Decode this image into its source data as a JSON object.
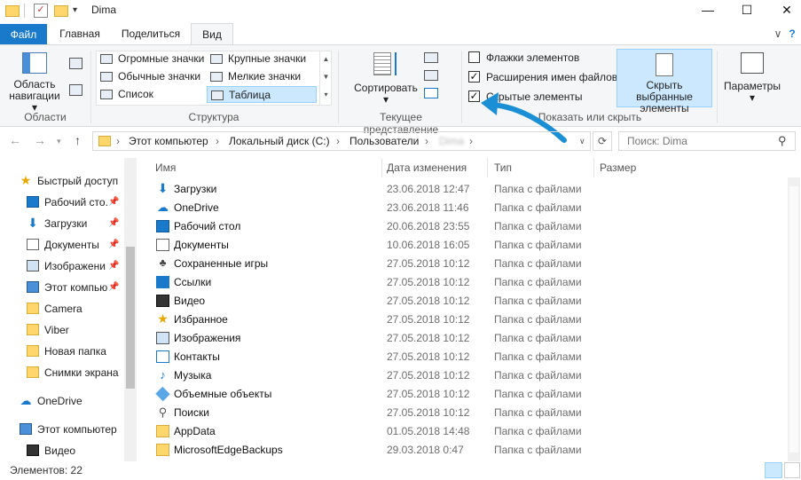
{
  "window": {
    "title": "Dima",
    "minimize": "—",
    "maximize": "☐",
    "close": "✕"
  },
  "tabs": {
    "file": "Файл",
    "home": "Главная",
    "share": "Поделиться",
    "view": "Вид",
    "help": "?",
    "collapse": "∨"
  },
  "ribbon": {
    "nav_pane": {
      "label_line1": "Область",
      "label_line2": "навигации ▾",
      "group": "Области"
    },
    "layout": {
      "items": [
        "Огромные значки",
        "Крупные значки",
        "Обычные значки",
        "Мелкие значки",
        "Список",
        "Таблица"
      ],
      "selected": "Таблица",
      "group": "Структура"
    },
    "current_view": {
      "sort_label": "Сортировать",
      "sort_arrow": "▾",
      "group": "Текущее представление"
    },
    "show_hide": {
      "checkboxes": [
        {
          "label": "Флажки элементов",
          "checked": false
        },
        {
          "label": "Расширения имен файлов",
          "checked": true
        },
        {
          "label": "Скрытые элементы",
          "checked": true
        }
      ],
      "hide_selected_line1": "Скрыть выбранные",
      "hide_selected_line2": "элементы",
      "group": "Показать или скрыть"
    },
    "options": {
      "label": "Параметры",
      "arrow": "▾"
    }
  },
  "address": {
    "crumbs": [
      "Этот компьютер",
      "Локальный диск (C:)",
      "Пользователи",
      "Dima"
    ],
    "separator": "›",
    "search_placeholder": "Поиск: Dima"
  },
  "nav_pane": {
    "items": [
      {
        "label": "Быстрый доступ",
        "icon": "star-icon"
      },
      {
        "label": "Рабочий сто.",
        "icon": "desktop-icon",
        "pinned": true
      },
      {
        "label": "Загрузки",
        "icon": "download-icon",
        "pinned": true
      },
      {
        "label": "Документы",
        "icon": "document-icon",
        "pinned": true
      },
      {
        "label": "Изображени",
        "icon": "pictures-icon",
        "pinned": true
      },
      {
        "label": "Этот компью",
        "icon": "computer-icon",
        "pinned": true
      },
      {
        "label": "Camera",
        "icon": "folder-icon"
      },
      {
        "label": "Viber",
        "icon": "folder-icon"
      },
      {
        "label": "Новая папка",
        "icon": "folder-icon"
      },
      {
        "label": "Снимки экрана",
        "icon": "folder-icon"
      },
      {
        "label": "OneDrive",
        "icon": "cloud-icon"
      },
      {
        "label": "Этот компьютер",
        "icon": "computer-icon"
      },
      {
        "label": "Видео",
        "icon": "video-icon"
      }
    ]
  },
  "columns": {
    "name": "Имя",
    "date": "Дата изменения",
    "type": "Тип",
    "size": "Размер"
  },
  "files": [
    {
      "name": "Загрузки",
      "date": "23.06.2018 12:47",
      "type": "Папка с файлами",
      "icon": "download-icon"
    },
    {
      "name": "OneDrive",
      "date": "23.06.2018 11:46",
      "type": "Папка с файлами",
      "icon": "cloud-icon"
    },
    {
      "name": "Рабочий стол",
      "date": "20.06.2018 23:55",
      "type": "Папка с файлами",
      "icon": "desktop-icon"
    },
    {
      "name": "Документы",
      "date": "10.06.2018 16:05",
      "type": "Папка с файлами",
      "icon": "document-icon"
    },
    {
      "name": "Сохраненные игры",
      "date": "27.05.2018 10:12",
      "type": "Папка с файлами",
      "icon": "game-icon"
    },
    {
      "name": "Ссылки",
      "date": "27.05.2018 10:12",
      "type": "Папка с файлами",
      "icon": "link-icon"
    },
    {
      "name": "Видео",
      "date": "27.05.2018 10:12",
      "type": "Папка с файлами",
      "icon": "video-icon"
    },
    {
      "name": "Избранное",
      "date": "27.05.2018 10:12",
      "type": "Папка с файлами",
      "icon": "star-icon"
    },
    {
      "name": "Изображения",
      "date": "27.05.2018 10:12",
      "type": "Папка с файлами",
      "icon": "pictures-icon"
    },
    {
      "name": "Контакты",
      "date": "27.05.2018 10:12",
      "type": "Папка с файлами",
      "icon": "contacts-icon"
    },
    {
      "name": "Музыка",
      "date": "27.05.2018 10:12",
      "type": "Папка с файлами",
      "icon": "music-icon"
    },
    {
      "name": "Объемные объекты",
      "date": "27.05.2018 10:12",
      "type": "Папка с файлами",
      "icon": "cube-icon"
    },
    {
      "name": "Поиски",
      "date": "27.05.2018 10:12",
      "type": "Папка с файлами",
      "icon": "search-icon"
    },
    {
      "name": "AppData",
      "date": "01.05.2018 14:48",
      "type": "Папка с файлами",
      "icon": "folder-icon"
    },
    {
      "name": "MicrosoftEdgeBackups",
      "date": "29.03.2018 0:47",
      "type": "Папка с файлами",
      "icon": "folder-icon"
    }
  ],
  "status": {
    "count": "Элементов: 22"
  },
  "colors": {
    "accent": "#1979ca",
    "selected": "#cce8ff",
    "annotation_arrow": "#1a8fd6"
  }
}
